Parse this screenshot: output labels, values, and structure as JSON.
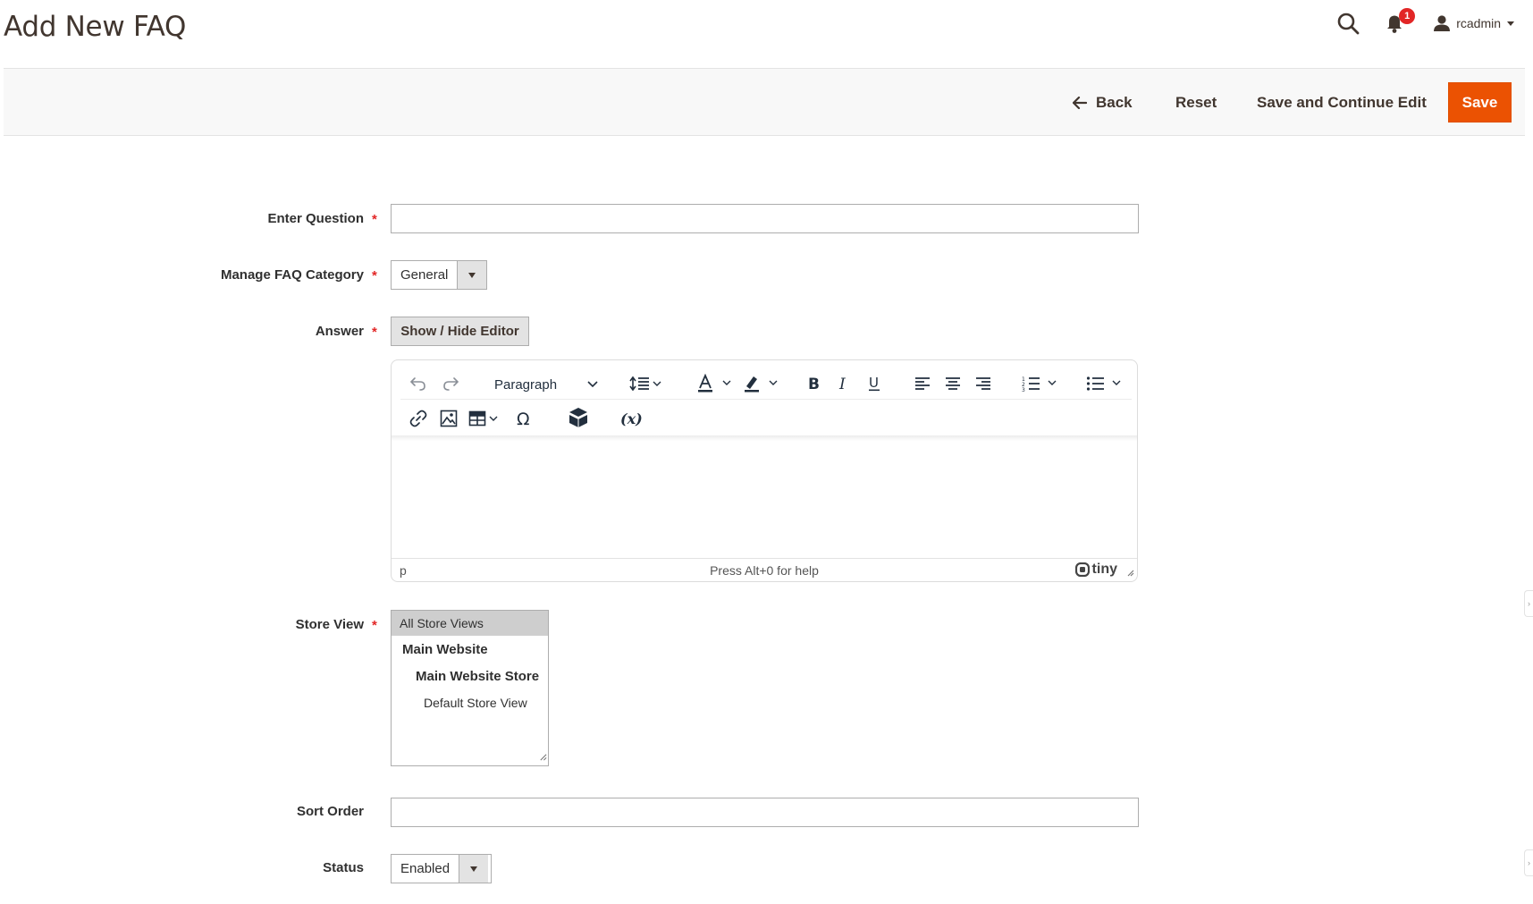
{
  "page": {
    "title": "Add New FAQ"
  },
  "header": {
    "notifications_count": "1",
    "username": "rcadmin"
  },
  "actions": {
    "back": "Back",
    "reset": "Reset",
    "save_continue": "Save and Continue Edit",
    "save": "Save",
    "save_color": "#eb5202"
  },
  "form": {
    "question": {
      "label": "Enter Question",
      "value": ""
    },
    "category": {
      "label": "Manage FAQ Category",
      "value": "General"
    },
    "answer": {
      "label": "Answer",
      "toggle_button": "Show / Hide Editor"
    },
    "editor": {
      "block_format": "Paragraph",
      "path": "p",
      "help": "Press Alt+0 for help",
      "brand": "tiny"
    },
    "store_view": {
      "label": "Store View",
      "options": [
        "All Store Views",
        "Main Website",
        "Main Website Store",
        "Default Store View"
      ],
      "selected": "All Store Views"
    },
    "sort_order": {
      "label": "Sort Order",
      "value": ""
    },
    "status": {
      "label": "Status",
      "value": "Enabled"
    }
  },
  "required_mark": "*",
  "colors": {
    "required": "#e22626",
    "title": "#41362f",
    "accent": "#eb5202"
  }
}
